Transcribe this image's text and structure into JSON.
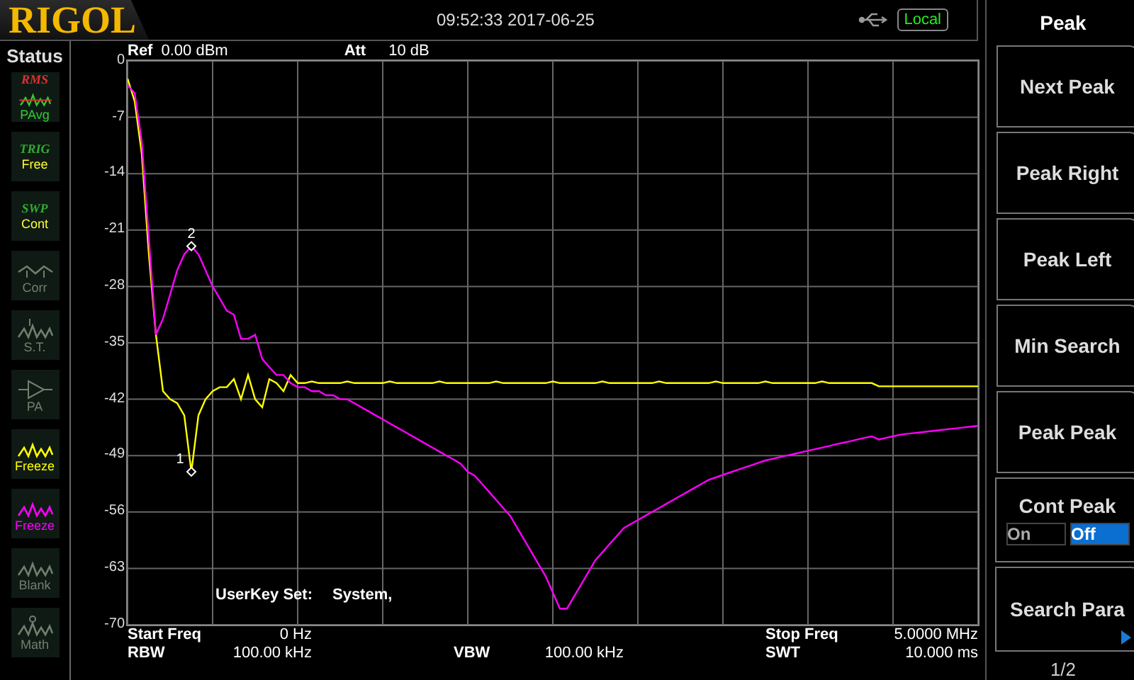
{
  "header": {
    "logo": "RIGOL",
    "datetime": "09:52:33 2017-06-25",
    "remote_badge": "Local"
  },
  "status": {
    "title": "Status",
    "items": [
      {
        "kind": "rms",
        "badge": "RMS",
        "label": "PAvg",
        "enabled": true,
        "color": "#33cc33"
      },
      {
        "kind": "trig",
        "badge": "TRIG",
        "label": "Free",
        "enabled": true,
        "color": "#ffff33"
      },
      {
        "kind": "swp",
        "badge": "SWP",
        "label": "Cont",
        "enabled": true,
        "color": "#ffff33"
      },
      {
        "kind": "corr",
        "label": "Corr",
        "enabled": false
      },
      {
        "kind": "st",
        "label": "S.T.",
        "enabled": false
      },
      {
        "kind": "pa",
        "label": "PA",
        "enabled": false
      },
      {
        "kind": "trace",
        "label": "Freeze",
        "enabled": true,
        "color": "#ffff00"
      },
      {
        "kind": "trace",
        "label": "Freeze",
        "enabled": true,
        "color": "#ff00ff"
      },
      {
        "kind": "trace",
        "label": "Blank",
        "enabled": false
      },
      {
        "kind": "math",
        "label": "Math",
        "enabled": false
      }
    ]
  },
  "settings": {
    "ref_label": "Ref",
    "ref_value": "0.00 dBm",
    "att_label": "Att",
    "att_value": "10 dB",
    "userkey_label": "UserKey Set:",
    "userkey_value": "System,"
  },
  "chart_data": {
    "type": "line",
    "ylim": [
      -70,
      0
    ],
    "yticks": [
      0,
      -7,
      -14,
      -21,
      -28,
      -35,
      -42,
      -49,
      -56,
      -63,
      -70
    ],
    "categories": [
      null,
      null,
      null,
      null,
      null,
      null,
      null,
      null,
      null,
      null,
      null,
      null,
      null,
      null,
      null,
      null,
      null,
      null,
      null,
      null,
      null,
      null,
      null,
      null,
      null,
      null,
      null,
      null,
      null,
      null,
      null,
      null,
      null,
      null,
      null,
      null,
      null,
      null,
      null,
      null,
      null,
      null,
      null,
      null,
      null,
      null,
      null,
      null,
      null,
      null,
      null,
      null,
      null,
      null,
      null,
      null,
      null,
      null,
      null,
      null,
      null,
      null,
      null,
      null,
      null,
      null,
      null,
      null,
      null,
      null,
      null,
      null,
      null,
      null,
      null,
      null,
      null,
      null,
      null,
      null,
      null,
      null,
      null,
      null,
      null,
      null,
      null,
      null,
      null,
      null,
      null,
      null,
      null,
      null,
      null,
      null,
      null,
      null,
      null,
      null,
      null,
      null,
      null,
      null,
      null,
      null,
      null,
      null,
      null,
      null,
      null,
      null,
      null,
      null,
      null,
      null,
      null,
      null,
      null,
      null,
      null
    ],
    "series": [
      {
        "color": "#ffff00",
        "values": [
          -2.2,
          -5,
          -11.5,
          -24,
          -34,
          -41,
          -42,
          -42.5,
          -44,
          -51,
          -44,
          -42,
          -41,
          -40.5,
          -40.5,
          -39.5,
          -42,
          -39,
          -42,
          -43,
          -39.5,
          -40,
          -41,
          -39,
          -40,
          -40,
          -39.8,
          -40,
          -40,
          -40,
          -40,
          -39.8,
          -40,
          -40,
          -40,
          -40,
          -40,
          -39.8,
          -40,
          -40,
          -40,
          -40,
          -40,
          -40,
          -39.8,
          -40,
          -40,
          -40,
          -40,
          -40,
          -40,
          -40,
          -39.8,
          -40,
          -40,
          -40,
          -40,
          -40,
          -40,
          -40,
          -39.8,
          -40,
          -40,
          -40,
          -40,
          -40,
          -40,
          -39.8,
          -40,
          -40,
          -40,
          -40,
          -40,
          -40,
          -40,
          -39.8,
          -40,
          -40,
          -40,
          -40,
          -40,
          -40,
          -40,
          -39.8,
          -40,
          -40,
          -40,
          -40,
          -40,
          -40,
          -39.8,
          -40,
          -40,
          -40,
          -40,
          -40,
          -40,
          -40,
          -39.8,
          -40,
          -40,
          -40,
          -40,
          -40,
          -40,
          -40,
          -40.4,
          -40.4,
          -40.4,
          -40.4,
          -40.4,
          -40.4,
          -40.4,
          -40.4,
          -40.4,
          -40.4,
          -40.4,
          -40.4,
          -40.4,
          -40.4,
          -40.4
        ]
      },
      {
        "color": "#ff00ff",
        "values": [
          -3,
          -4,
          -10,
          -22,
          -34,
          -32,
          -29,
          -26,
          -24,
          -23,
          -24,
          -26,
          -28,
          -29.5,
          -31,
          -31.5,
          -34.5,
          -34.5,
          -34,
          -37,
          -38,
          -39,
          -39,
          -40,
          -40.5,
          -40.5,
          -41,
          -41,
          -41.5,
          -41.5,
          -42,
          -42,
          -42.5,
          -43,
          -43.5,
          -44,
          -44.5,
          -45,
          -45.5,
          -46,
          -46.5,
          -47,
          -47.5,
          -48,
          -48.5,
          -49,
          -49.5,
          -50,
          -51,
          -51.5,
          -52.5,
          -53.5,
          -54.5,
          -55.5,
          -56.5,
          -58,
          -59.5,
          -61,
          -62.5,
          -64,
          -66,
          -68,
          -68,
          -66.5,
          -65,
          -63.5,
          -62,
          -61,
          -60,
          -59,
          -58,
          -57.5,
          -57,
          -56.5,
          -56,
          -55.5,
          -55,
          -54.5,
          -54,
          -53.5,
          -53,
          -52.5,
          -52,
          -51.7,
          -51.4,
          -51.1,
          -50.8,
          -50.5,
          -50.2,
          -49.9,
          -49.6,
          -49.4,
          -49.2,
          -49,
          -48.8,
          -48.6,
          -48.4,
          -48.2,
          -48,
          -47.8,
          -47.6,
          -47.4,
          -47.2,
          -47,
          -46.8,
          -46.6,
          -47,
          -46.8,
          -46.6,
          -46.4,
          -46.3,
          -46.2,
          -46.1,
          -46,
          -45.9,
          -45.8,
          -45.7,
          -45.6,
          -45.5,
          -45.4,
          -45.3
        ]
      }
    ],
    "grid": true,
    "annotations": [
      {
        "text": "1",
        "y": -51
      },
      {
        "text": "2",
        "y": -23
      }
    ]
  },
  "footer": [
    {
      "label": "Start Freq",
      "value": "0 Hz"
    },
    {
      "label": "Stop Freq",
      "value": "5.0000 MHz"
    },
    {
      "label": "RBW",
      "value": "100.00 kHz"
    },
    {
      "label": "VBW",
      "value": "100.00 kHz"
    },
    {
      "label": "SWT",
      "value": "10.000 ms"
    }
  ],
  "menu": {
    "title": "Peak",
    "page": "1/2",
    "keys": [
      {
        "kind": "button",
        "label": "Next Peak"
      },
      {
        "kind": "button",
        "label": "Peak Right"
      },
      {
        "kind": "button",
        "label": "Peak Left"
      },
      {
        "kind": "button",
        "label": "Min Search"
      },
      {
        "kind": "button",
        "label": "Peak Peak"
      },
      {
        "kind": "toggle",
        "label": "Cont Peak",
        "options": [
          {
            "label": "On",
            "selected": false
          },
          {
            "label": "Off",
            "selected": true
          }
        ]
      },
      {
        "kind": "submenu",
        "label": "Search Para"
      }
    ]
  }
}
